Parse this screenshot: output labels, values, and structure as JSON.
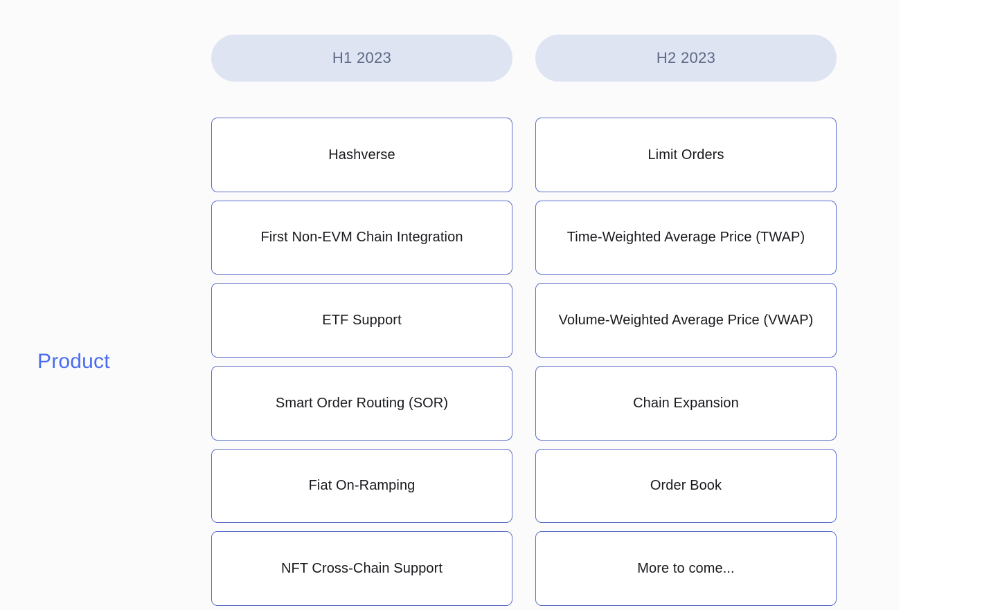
{
  "row": {
    "label": "Product"
  },
  "columns": [
    {
      "header": "H1 2023"
    },
    {
      "header": "H2 2023"
    }
  ],
  "cards": {
    "h1_2023": [
      {
        "label": "Hashverse"
      },
      {
        "label": "First Non-EVM Chain Integration"
      },
      {
        "label": "ETF Support"
      },
      {
        "label": "Smart Order Routing (SOR)"
      },
      {
        "label": "Fiat On-Ramping"
      },
      {
        "label": "NFT Cross-Chain Support"
      }
    ],
    "h2_2023": [
      {
        "label": "Limit Orders"
      },
      {
        "label": "Time-Weighted Average Price (TWAP)"
      },
      {
        "label": "Volume-Weighted Average Price (VWAP)"
      },
      {
        "label": "Chain Expansion"
      },
      {
        "label": "Order Book"
      },
      {
        "label": "More to come..."
      }
    ]
  },
  "colors": {
    "panel_background": "#fbfbfc",
    "page_background": "#ffffff",
    "row_label_text": "#4a6cf0",
    "header_pill_background": "#dee4f2",
    "header_pill_text": "#5d6a85",
    "card_border": "#5b6fc9",
    "card_background": "#ffffff",
    "card_text": "#17181c"
  }
}
